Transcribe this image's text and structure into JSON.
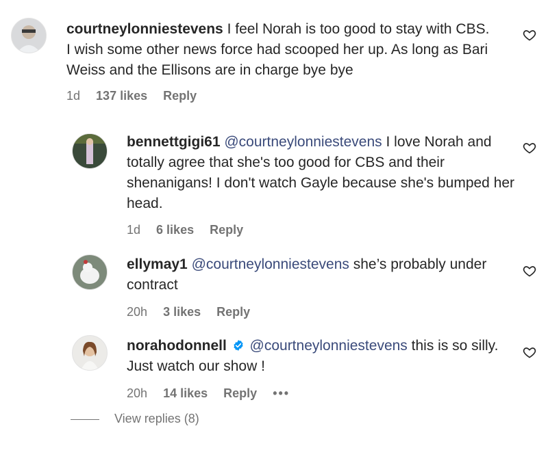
{
  "comments": [
    {
      "username": "courtneylonniestevens",
      "mention": "",
      "text": "I feel Norah is too good to stay with CBS. I wish some other news force had scooped her up. As long as Bari Weiss and the Ellisons are in charge bye bye",
      "time": "1d",
      "likes": "137 likes",
      "reply": "Reply"
    },
    {
      "username": "bennettgigi61",
      "mention": "@courtneylonniestevens",
      "text": "I love Norah and totally agree that she's too good for CBS and their shenanigans! I don't watch Gayle because she's bumped her head.",
      "time": "1d",
      "likes": "6 likes",
      "reply": "Reply"
    },
    {
      "username": "ellymay1",
      "mention": "@courtneylonniestevens",
      "text": "she’s probably under contract",
      "time": "20h",
      "likes": "3 likes",
      "reply": "Reply"
    },
    {
      "username": "norahodonnell",
      "mention": "@courtneylonniestevens",
      "text": "this is so silly. Just watch our show !",
      "time": "20h",
      "likes": "14 likes",
      "reply": "Reply",
      "more": "•••",
      "verified": true
    }
  ],
  "view_replies": "View replies (8)",
  "icons": {
    "heart": "heart-outline-icon",
    "verified": "verified-badge-icon",
    "verified_color": "#0095f6"
  }
}
